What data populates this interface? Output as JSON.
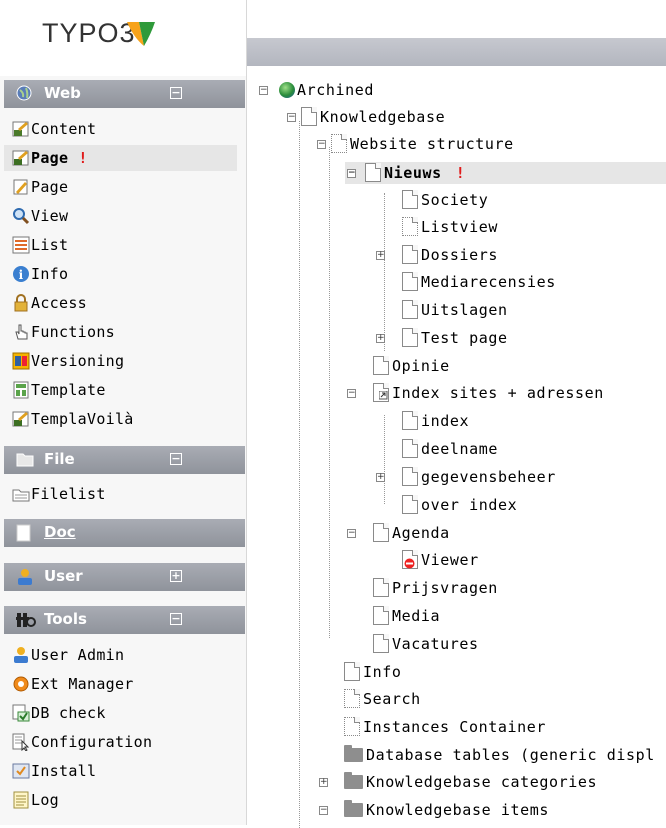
{
  "logo": {
    "text": "TYPO3"
  },
  "web": {
    "title": "Web",
    "items": [
      {
        "label": "Content",
        "icon": "content-icon"
      },
      {
        "label": "Page",
        "icon": "page-tv-icon",
        "active": true,
        "alert": "!"
      },
      {
        "label": "Page",
        "icon": "page-edit-icon"
      },
      {
        "label": "View",
        "icon": "magnifier-icon"
      },
      {
        "label": "List",
        "icon": "list-icon"
      },
      {
        "label": "Info",
        "icon": "info-icon"
      },
      {
        "label": "Access",
        "icon": "lock-icon"
      },
      {
        "label": "Functions",
        "icon": "hand-icon"
      },
      {
        "label": "Versioning",
        "icon": "versioning-icon"
      },
      {
        "label": "Template",
        "icon": "template-icon"
      },
      {
        "label": "TemplaVoilà",
        "icon": "templavoila-icon"
      }
    ]
  },
  "file": {
    "title": "File",
    "items": [
      {
        "label": "Filelist",
        "icon": "filelist-icon"
      }
    ]
  },
  "doc": {
    "title": "Doc"
  },
  "user": {
    "title": "User"
  },
  "tools": {
    "title": "Tools",
    "items": [
      {
        "label": "User Admin",
        "icon": "user-admin-icon"
      },
      {
        "label": "Ext Manager",
        "icon": "ext-manager-icon"
      },
      {
        "label": "DB check",
        "icon": "db-check-icon"
      },
      {
        "label": "Configuration",
        "icon": "configuration-icon"
      },
      {
        "label": "Install",
        "icon": "install-icon"
      },
      {
        "label": "Log",
        "icon": "log-icon"
      }
    ]
  },
  "tree": {
    "nodes": [
      {
        "label": "Archined",
        "icon": "globe"
      },
      {
        "label": "Knowledgebase",
        "icon": "page"
      },
      {
        "label": "Website structure",
        "icon": "page-dotted"
      },
      {
        "label": "Nieuws",
        "icon": "page",
        "alert": "!"
      },
      {
        "label": "Society",
        "icon": "page"
      },
      {
        "label": "Listview",
        "icon": "page-dotted"
      },
      {
        "label": "Dossiers",
        "icon": "page"
      },
      {
        "label": "Mediarecensies",
        "icon": "page"
      },
      {
        "label": "Uitslagen",
        "icon": "page"
      },
      {
        "label": "Test page",
        "icon": "page"
      },
      {
        "label": "Opinie",
        "icon": "page"
      },
      {
        "label": "Index sites + adressen",
        "icon": "page-shortcut"
      },
      {
        "label": "index",
        "icon": "page"
      },
      {
        "label": "deelname",
        "icon": "page"
      },
      {
        "label": "gegevensbeheer",
        "icon": "page"
      },
      {
        "label": "over index",
        "icon": "page"
      },
      {
        "label": "Agenda",
        "icon": "page"
      },
      {
        "label": "Viewer",
        "icon": "page-restricted"
      },
      {
        "label": "Prijsvragen",
        "icon": "page"
      },
      {
        "label": "Media",
        "icon": "page"
      },
      {
        "label": "Vacatures",
        "icon": "page"
      },
      {
        "label": "Info",
        "icon": "page"
      },
      {
        "label": "Search",
        "icon": "page-dotted"
      },
      {
        "label": "Instances Container",
        "icon": "page-dotted"
      },
      {
        "label": "Database tables (generic displ",
        "icon": "folder"
      },
      {
        "label": "Knowledgebase categories",
        "icon": "folder"
      },
      {
        "label": "Knowledgebase items",
        "icon": "folder"
      }
    ]
  },
  "colors": {
    "alert": "#e01b1b",
    "section": "#9a9ea6",
    "highlight": "#e6e6e6"
  }
}
